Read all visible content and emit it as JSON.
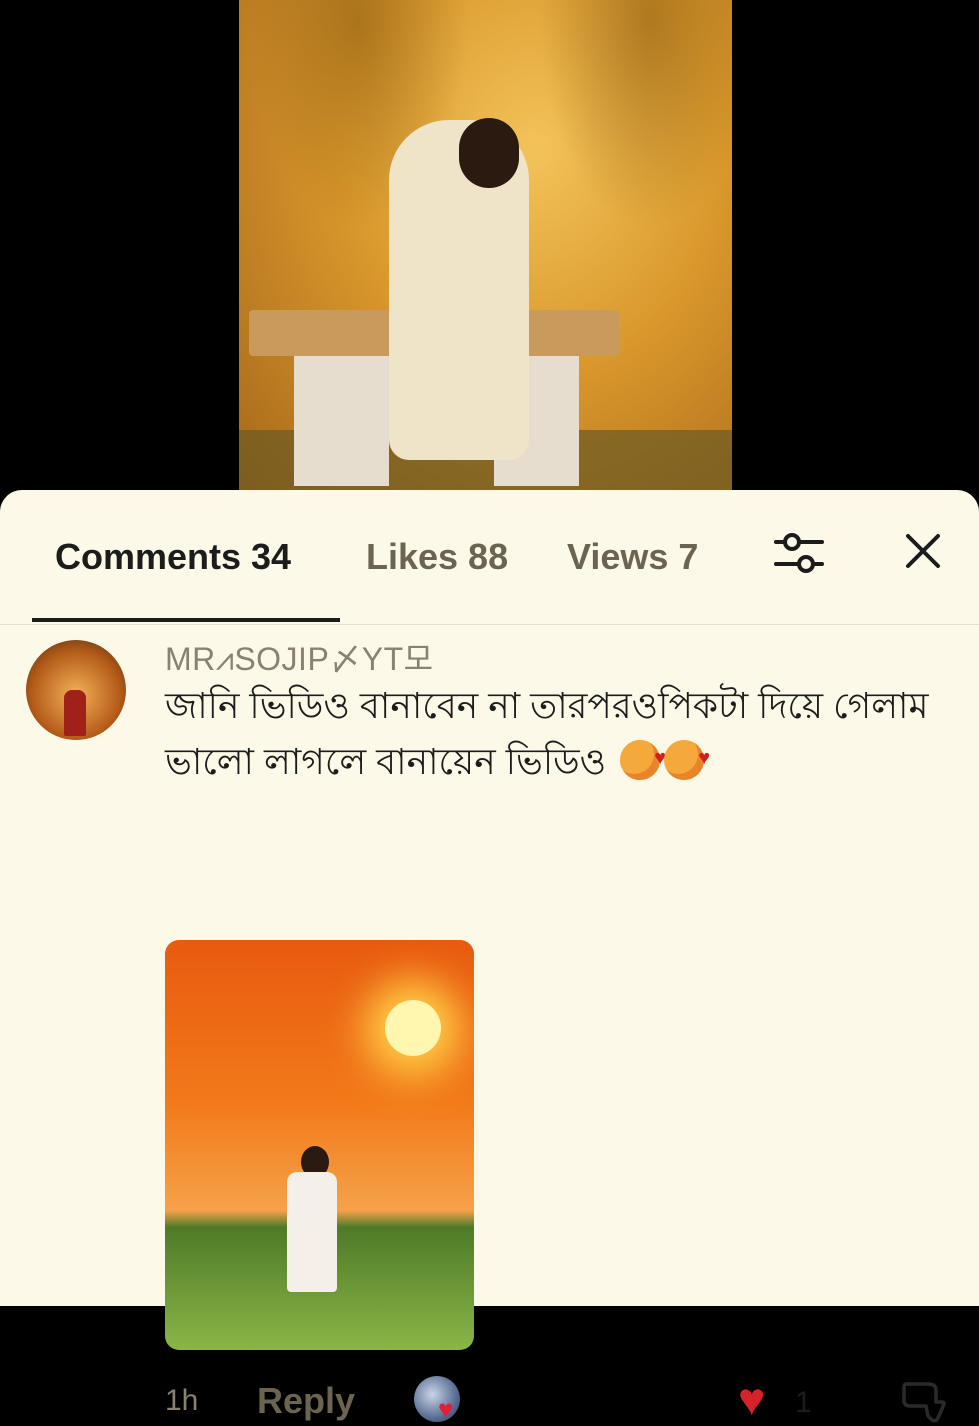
{
  "tabs": {
    "comments": "Comments 34",
    "likes": "Likes 88",
    "views": "Views 7"
  },
  "icons": {
    "filter": "sliders-icon",
    "close": "close-icon",
    "like": "heart-icon",
    "dislike": "thumbs-down-icon"
  },
  "comment": {
    "author": "MR⩘SOJIP〆YT모",
    "text": "জানি ভিডিও বানাবেন না তারপরওপিকটা দিয়ে গেলাম ভালো লাগলে বানায়েন ভিডিও",
    "time": "1h",
    "reply_label": "Reply",
    "like_count": "1"
  },
  "colors": {
    "sheet_bg": "#fdf9e8",
    "heart": "#d8222a"
  }
}
